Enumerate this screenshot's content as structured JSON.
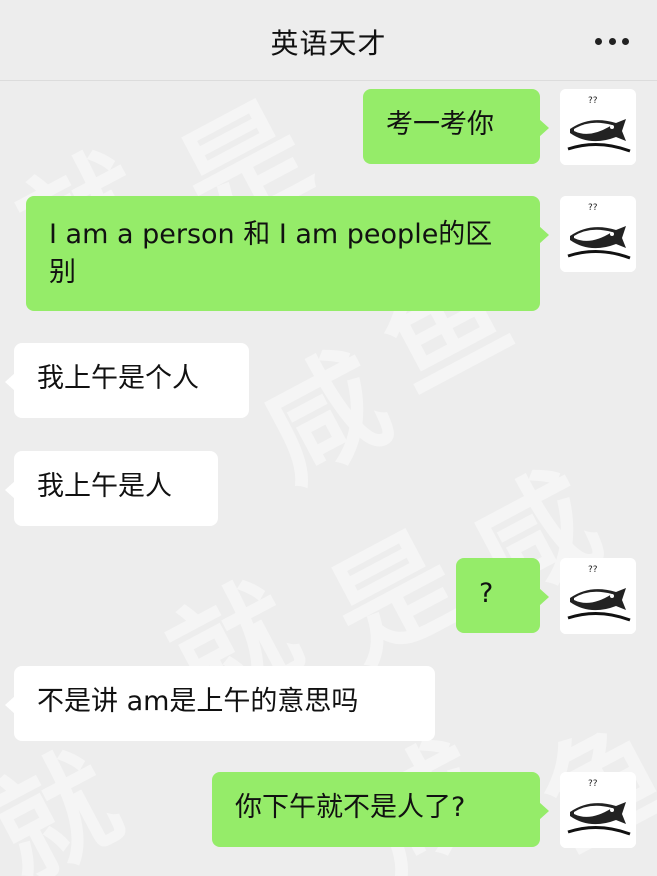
{
  "header": {
    "title": "英语天才",
    "more_icon": "more-dots-icon"
  },
  "watermark": {
    "chars": [
      "就",
      "是",
      "咸",
      "鱼"
    ]
  },
  "messages": [
    {
      "from": "me",
      "text": "考一考你"
    },
    {
      "from": "me",
      "text": "I am a person 和 I am people的区别"
    },
    {
      "from": "other",
      "text": "我上午是个人"
    },
    {
      "from": "other",
      "text": "我上午是人"
    },
    {
      "from": "me",
      "text": "?"
    },
    {
      "from": "other",
      "text": "不是讲 am是上午的意思吗"
    },
    {
      "from": "me",
      "text": "你下午就不是人了?"
    }
  ],
  "colors": {
    "background": "#ededed",
    "my_bubble": "#95ec69",
    "other_bubble": "#ffffff"
  }
}
